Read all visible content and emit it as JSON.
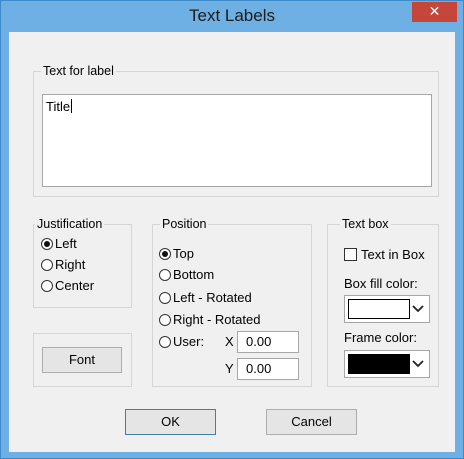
{
  "window": {
    "title": "Text Labels",
    "close_symbol": "✕"
  },
  "text_group": {
    "legend": "Text for label",
    "value": "Title"
  },
  "justification": {
    "legend": "Justification",
    "options": [
      {
        "label": "Left",
        "checked": true
      },
      {
        "label": "Right",
        "checked": false
      },
      {
        "label": "Center",
        "checked": false
      }
    ]
  },
  "position": {
    "legend": "Position",
    "options": [
      {
        "label": "Top",
        "checked": true
      },
      {
        "label": "Bottom",
        "checked": false
      },
      {
        "label": "Left - Rotated",
        "checked": false
      },
      {
        "label": "Right - Rotated",
        "checked": false
      },
      {
        "label": "User:",
        "checked": false
      }
    ],
    "x_label": "X",
    "x_value": "0.00",
    "y_label": "Y",
    "y_value": "0.00"
  },
  "text_box": {
    "legend": "Text box",
    "checkbox_label": "Text in Box",
    "checked": false,
    "fill_label": "Box fill color:",
    "fill_color": "#ffffff",
    "frame_label": "Frame color:",
    "frame_color": "#000000"
  },
  "buttons": {
    "font": "Font",
    "ok": "OK",
    "cancel": "Cancel"
  },
  "colors": {
    "titlebar": "#6fb0e4",
    "close_button": "#c7463c",
    "dialog_background": "#f0f0f0"
  }
}
